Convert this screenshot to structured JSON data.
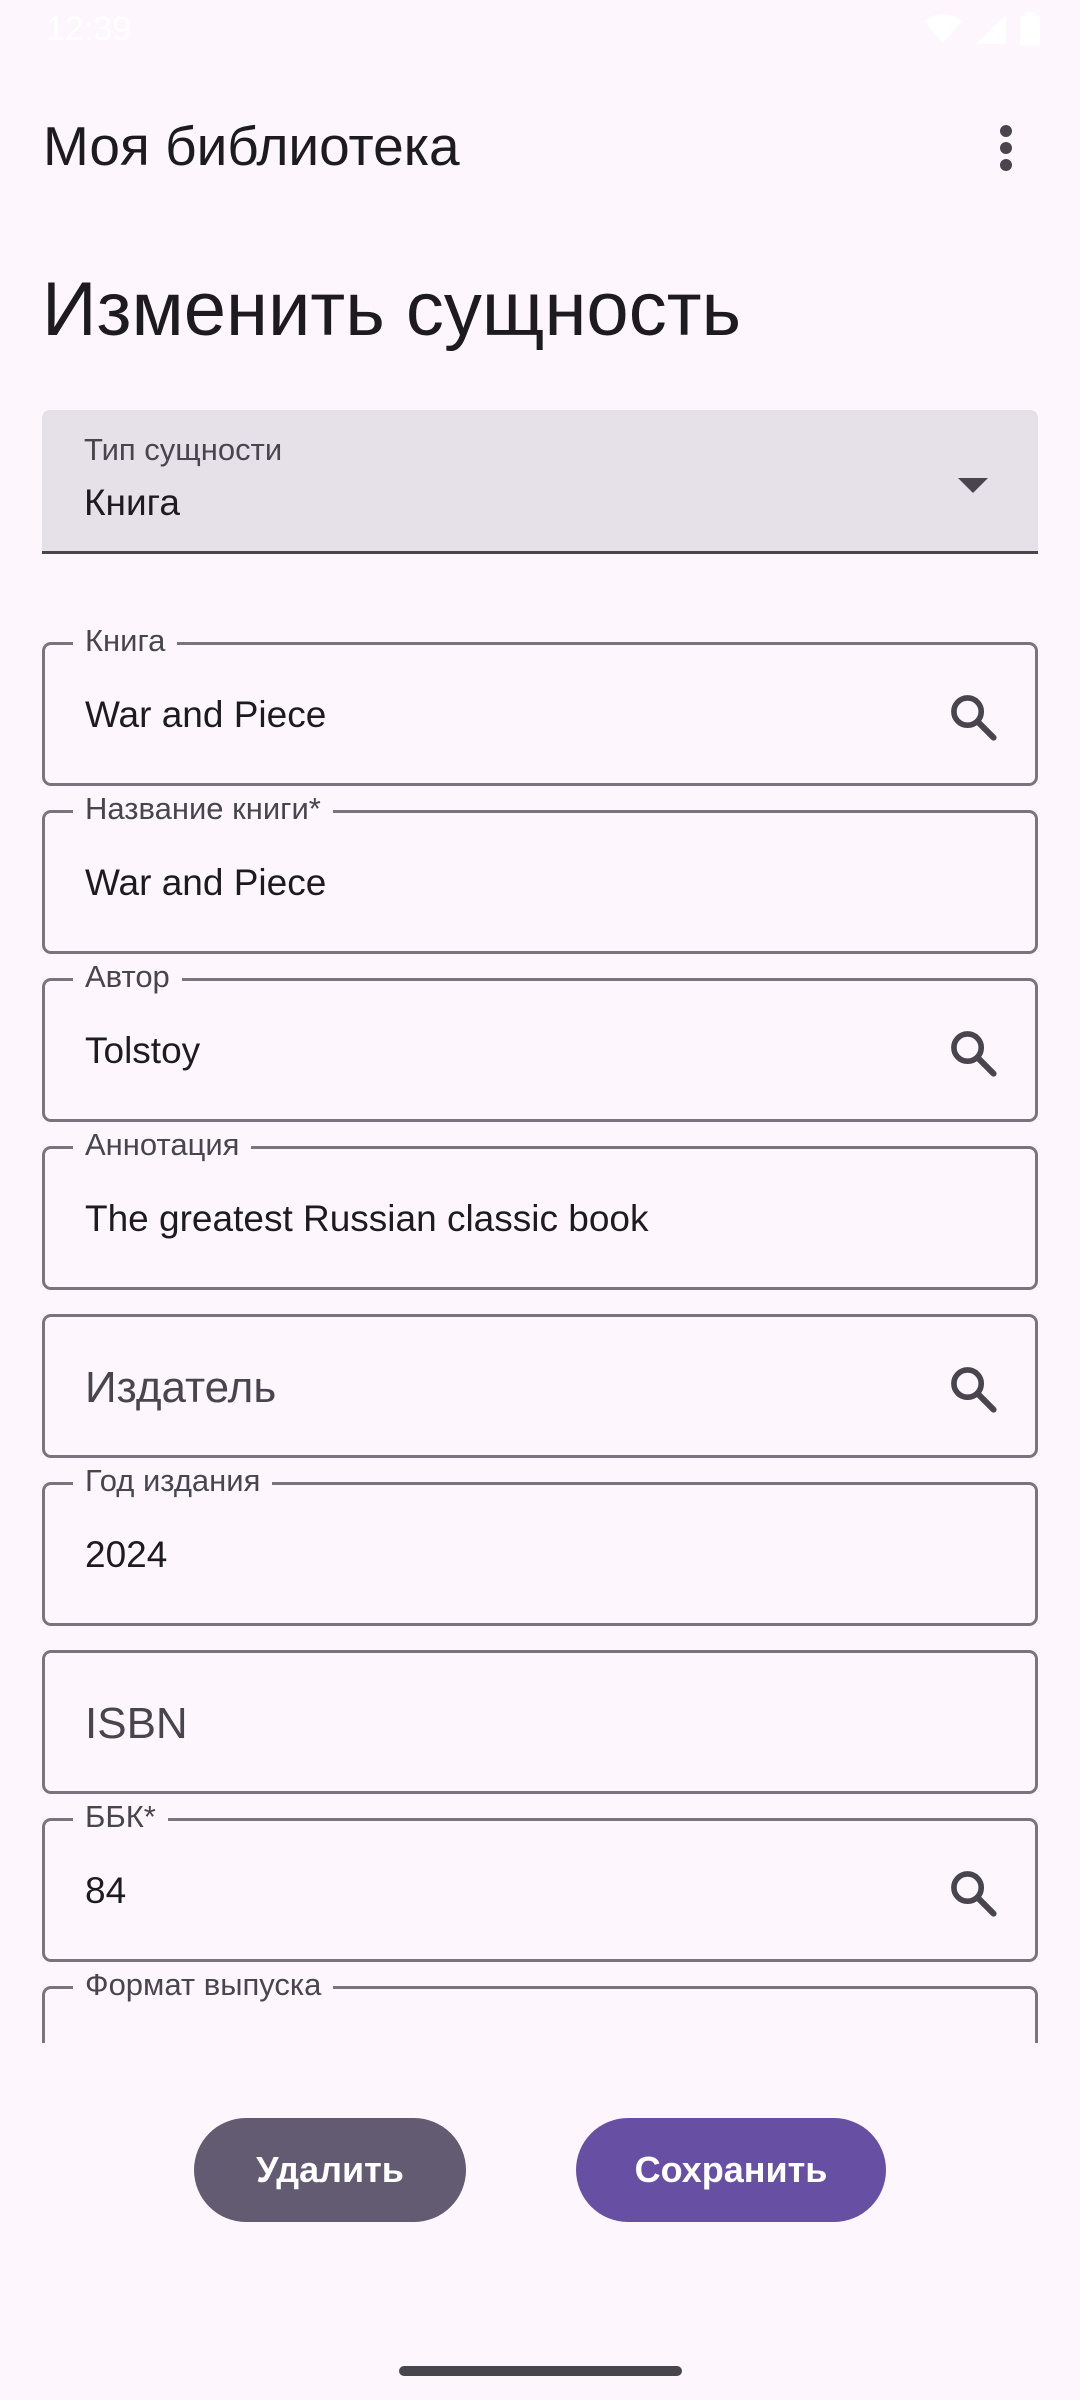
{
  "status_bar": {
    "time": "12:39"
  },
  "app_bar": {
    "title": "Моя библиотека",
    "menu_icon": "more-vert-icon"
  },
  "page": {
    "title": "Изменить сущность"
  },
  "entity_type": {
    "label": "Тип сущности",
    "value": "Книга"
  },
  "fields": [
    {
      "id": "book",
      "label": "Книга",
      "value": "War and Piece",
      "icon": "search-icon"
    },
    {
      "id": "book_title",
      "label": "Название книги*",
      "value": "War and Piece"
    },
    {
      "id": "author",
      "label": "Автор",
      "value": "Tolstoy",
      "icon": "search-icon"
    },
    {
      "id": "annotation",
      "label": "Аннотация",
      "value": "The greatest Russian classic book"
    },
    {
      "id": "publisher",
      "placeholder": "Издатель",
      "icon": "search-icon"
    },
    {
      "id": "year",
      "label": "Год издания",
      "value": "2024"
    },
    {
      "id": "isbn",
      "placeholder": "ISBN"
    },
    {
      "id": "bbk",
      "label": "ББК*",
      "value": "84",
      "icon": "search-icon"
    },
    {
      "id": "format",
      "label": "Формат выпуска",
      "value": ""
    }
  ],
  "actions": {
    "delete_label": "Удалить",
    "save_label": "Сохранить"
  },
  "colors": {
    "background": "#fdf7fd",
    "primary": "#6750a4",
    "secondary": "#625b71",
    "outline": "#79747e"
  }
}
